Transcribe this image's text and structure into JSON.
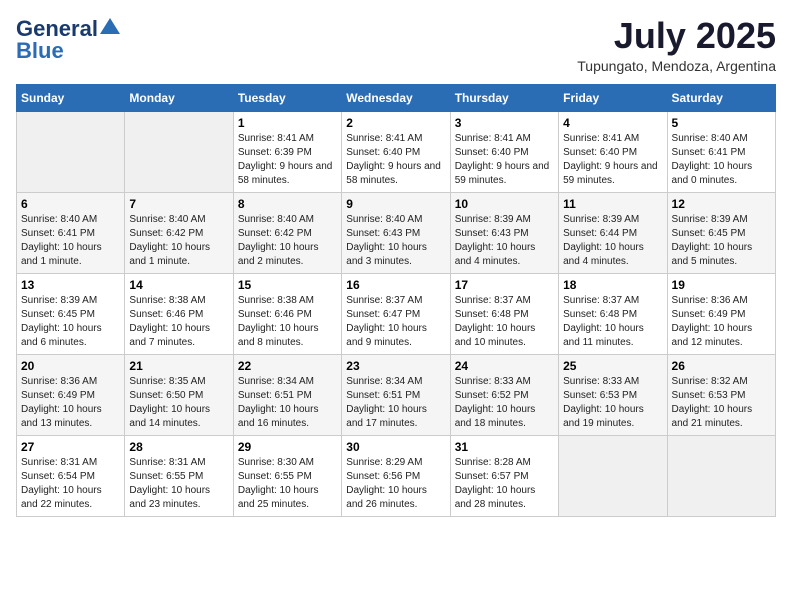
{
  "header": {
    "logo_line1": "General",
    "logo_line2": "Blue",
    "month_title": "July 2025",
    "location": "Tupungato, Mendoza, Argentina"
  },
  "weekdays": [
    "Sunday",
    "Monday",
    "Tuesday",
    "Wednesday",
    "Thursday",
    "Friday",
    "Saturday"
  ],
  "weeks": [
    [
      {
        "day": null
      },
      {
        "day": null
      },
      {
        "day": "1",
        "sunrise": "Sunrise: 8:41 AM",
        "sunset": "Sunset: 6:39 PM",
        "daylight": "Daylight: 9 hours and 58 minutes."
      },
      {
        "day": "2",
        "sunrise": "Sunrise: 8:41 AM",
        "sunset": "Sunset: 6:40 PM",
        "daylight": "Daylight: 9 hours and 58 minutes."
      },
      {
        "day": "3",
        "sunrise": "Sunrise: 8:41 AM",
        "sunset": "Sunset: 6:40 PM",
        "daylight": "Daylight: 9 hours and 59 minutes."
      },
      {
        "day": "4",
        "sunrise": "Sunrise: 8:41 AM",
        "sunset": "Sunset: 6:40 PM",
        "daylight": "Daylight: 9 hours and 59 minutes."
      },
      {
        "day": "5",
        "sunrise": "Sunrise: 8:40 AM",
        "sunset": "Sunset: 6:41 PM",
        "daylight": "Daylight: 10 hours and 0 minutes."
      }
    ],
    [
      {
        "day": "6",
        "sunrise": "Sunrise: 8:40 AM",
        "sunset": "Sunset: 6:41 PM",
        "daylight": "Daylight: 10 hours and 1 minute."
      },
      {
        "day": "7",
        "sunrise": "Sunrise: 8:40 AM",
        "sunset": "Sunset: 6:42 PM",
        "daylight": "Daylight: 10 hours and 1 minute."
      },
      {
        "day": "8",
        "sunrise": "Sunrise: 8:40 AM",
        "sunset": "Sunset: 6:42 PM",
        "daylight": "Daylight: 10 hours and 2 minutes."
      },
      {
        "day": "9",
        "sunrise": "Sunrise: 8:40 AM",
        "sunset": "Sunset: 6:43 PM",
        "daylight": "Daylight: 10 hours and 3 minutes."
      },
      {
        "day": "10",
        "sunrise": "Sunrise: 8:39 AM",
        "sunset": "Sunset: 6:43 PM",
        "daylight": "Daylight: 10 hours and 4 minutes."
      },
      {
        "day": "11",
        "sunrise": "Sunrise: 8:39 AM",
        "sunset": "Sunset: 6:44 PM",
        "daylight": "Daylight: 10 hours and 4 minutes."
      },
      {
        "day": "12",
        "sunrise": "Sunrise: 8:39 AM",
        "sunset": "Sunset: 6:45 PM",
        "daylight": "Daylight: 10 hours and 5 minutes."
      }
    ],
    [
      {
        "day": "13",
        "sunrise": "Sunrise: 8:39 AM",
        "sunset": "Sunset: 6:45 PM",
        "daylight": "Daylight: 10 hours and 6 minutes."
      },
      {
        "day": "14",
        "sunrise": "Sunrise: 8:38 AM",
        "sunset": "Sunset: 6:46 PM",
        "daylight": "Daylight: 10 hours and 7 minutes."
      },
      {
        "day": "15",
        "sunrise": "Sunrise: 8:38 AM",
        "sunset": "Sunset: 6:46 PM",
        "daylight": "Daylight: 10 hours and 8 minutes."
      },
      {
        "day": "16",
        "sunrise": "Sunrise: 8:37 AM",
        "sunset": "Sunset: 6:47 PM",
        "daylight": "Daylight: 10 hours and 9 minutes."
      },
      {
        "day": "17",
        "sunrise": "Sunrise: 8:37 AM",
        "sunset": "Sunset: 6:48 PM",
        "daylight": "Daylight: 10 hours and 10 minutes."
      },
      {
        "day": "18",
        "sunrise": "Sunrise: 8:37 AM",
        "sunset": "Sunset: 6:48 PM",
        "daylight": "Daylight: 10 hours and 11 minutes."
      },
      {
        "day": "19",
        "sunrise": "Sunrise: 8:36 AM",
        "sunset": "Sunset: 6:49 PM",
        "daylight": "Daylight: 10 hours and 12 minutes."
      }
    ],
    [
      {
        "day": "20",
        "sunrise": "Sunrise: 8:36 AM",
        "sunset": "Sunset: 6:49 PM",
        "daylight": "Daylight: 10 hours and 13 minutes."
      },
      {
        "day": "21",
        "sunrise": "Sunrise: 8:35 AM",
        "sunset": "Sunset: 6:50 PM",
        "daylight": "Daylight: 10 hours and 14 minutes."
      },
      {
        "day": "22",
        "sunrise": "Sunrise: 8:34 AM",
        "sunset": "Sunset: 6:51 PM",
        "daylight": "Daylight: 10 hours and 16 minutes."
      },
      {
        "day": "23",
        "sunrise": "Sunrise: 8:34 AM",
        "sunset": "Sunset: 6:51 PM",
        "daylight": "Daylight: 10 hours and 17 minutes."
      },
      {
        "day": "24",
        "sunrise": "Sunrise: 8:33 AM",
        "sunset": "Sunset: 6:52 PM",
        "daylight": "Daylight: 10 hours and 18 minutes."
      },
      {
        "day": "25",
        "sunrise": "Sunrise: 8:33 AM",
        "sunset": "Sunset: 6:53 PM",
        "daylight": "Daylight: 10 hours and 19 minutes."
      },
      {
        "day": "26",
        "sunrise": "Sunrise: 8:32 AM",
        "sunset": "Sunset: 6:53 PM",
        "daylight": "Daylight: 10 hours and 21 minutes."
      }
    ],
    [
      {
        "day": "27",
        "sunrise": "Sunrise: 8:31 AM",
        "sunset": "Sunset: 6:54 PM",
        "daylight": "Daylight: 10 hours and 22 minutes."
      },
      {
        "day": "28",
        "sunrise": "Sunrise: 8:31 AM",
        "sunset": "Sunset: 6:55 PM",
        "daylight": "Daylight: 10 hours and 23 minutes."
      },
      {
        "day": "29",
        "sunrise": "Sunrise: 8:30 AM",
        "sunset": "Sunset: 6:55 PM",
        "daylight": "Daylight: 10 hours and 25 minutes."
      },
      {
        "day": "30",
        "sunrise": "Sunrise: 8:29 AM",
        "sunset": "Sunset: 6:56 PM",
        "daylight": "Daylight: 10 hours and 26 minutes."
      },
      {
        "day": "31",
        "sunrise": "Sunrise: 8:28 AM",
        "sunset": "Sunset: 6:57 PM",
        "daylight": "Daylight: 10 hours and 28 minutes."
      },
      {
        "day": null
      },
      {
        "day": null
      }
    ]
  ]
}
